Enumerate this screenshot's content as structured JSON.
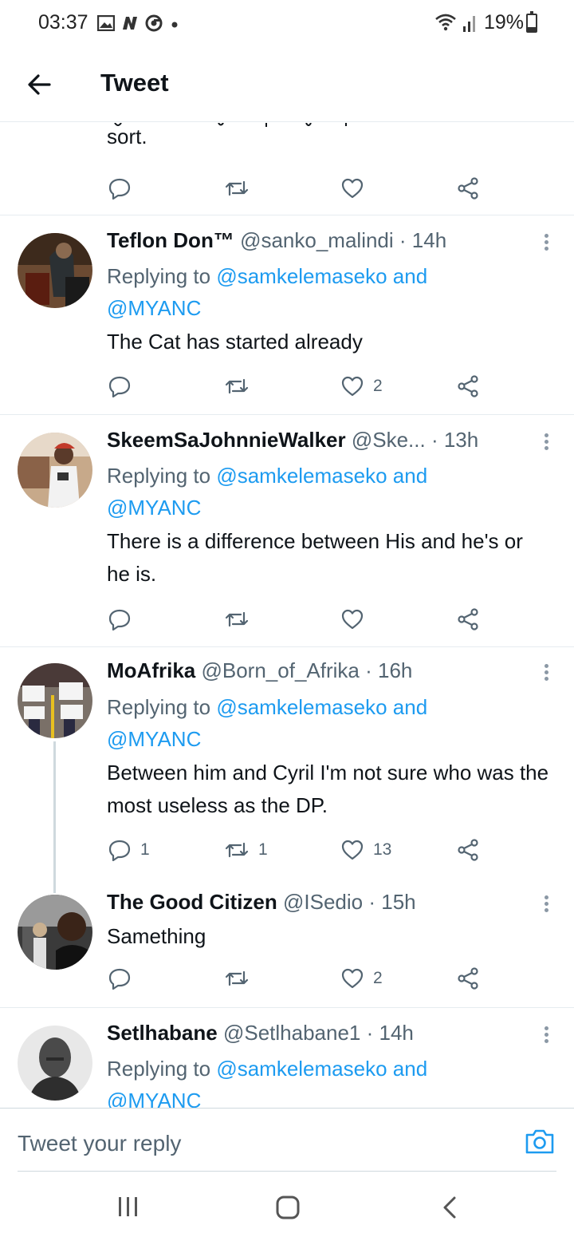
{
  "status": {
    "time": "03:37",
    "battery": "19%",
    "icons": [
      "gallery-icon",
      "n-app-icon",
      "chrome-icon",
      "dot-icon",
      "wifi-icon",
      "signal-icon",
      "battery-icon"
    ]
  },
  "header": {
    "title": "Tweet",
    "back_icon": "back-arrow-icon"
  },
  "partial_tweet": {
    "text": "sort."
  },
  "reply_prefix": "Replying to",
  "tweets": [
    {
      "name": "Teflon Don™",
      "handle": "@sanko_malindi",
      "time": "· 14h",
      "mentions": "@samkelemaseko and",
      "mentions2": "@MYANC",
      "body": "The Cat has started already",
      "counts": {
        "reply": "",
        "retweet": "",
        "like": "2"
      }
    },
    {
      "name": "SkeemSaJohnnieWalker",
      "handle": "@Ske...",
      "time": "· 13h",
      "mentions": "@samkelemaseko and",
      "mentions2": "@MYANC",
      "body": "There is a difference between His and he's or he is.",
      "counts": {
        "reply": "",
        "retweet": "",
        "like": ""
      }
    },
    {
      "name": "MoAfrika",
      "handle": "@Born_of_Afrika",
      "time": "· 16h",
      "mentions": "@samkelemaseko and",
      "mentions2": "@MYANC",
      "body": "Between him and Cyril I'm not sure who was the most useless as the DP.",
      "counts": {
        "reply": "1",
        "retweet": "1",
        "like": "13"
      }
    },
    {
      "name": "The Good Citizen",
      "handle": "@ISedio",
      "time": "· 15h",
      "body": "Samething",
      "counts": {
        "reply": "",
        "retweet": "",
        "like": "2"
      }
    },
    {
      "name": "Setlhabane",
      "handle": "@Setlhabane1",
      "time": "· 14h",
      "mentions": "@samkelemaseko and",
      "mentions2": "@MYANC"
    }
  ],
  "reply_bar": {
    "placeholder": "Tweet your reply",
    "camera_icon": "camera-icon"
  },
  "nav": {
    "icons": [
      "recents-icon",
      "home-icon",
      "back-icon"
    ]
  },
  "colors": {
    "accent": "#1d9bf0",
    "text": "#0f1419",
    "muted": "#536471",
    "divider": "#e6ecf0"
  }
}
